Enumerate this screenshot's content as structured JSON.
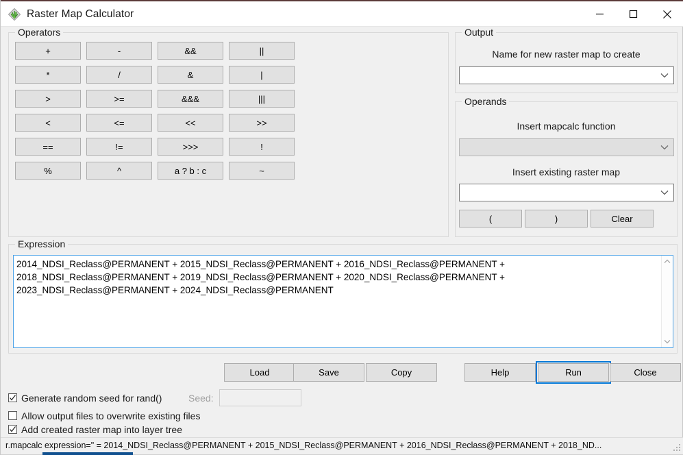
{
  "window": {
    "title": "Raster Map Calculator",
    "icon": "grass-gis-icon",
    "minimize_label": "Minimize",
    "maximize_label": "Maximize",
    "close_label": "Close"
  },
  "operators": {
    "legend": "Operators",
    "buttons": [
      "+",
      "-",
      "&&",
      "||",
      "*",
      "/",
      "&",
      "|",
      ">",
      ">=",
      "&&&",
      "|||",
      "<",
      "<=",
      "<<",
      ">>",
      "==",
      "!=",
      ">>>",
      "!",
      "%",
      "^",
      "a ? b : c",
      "~"
    ]
  },
  "output": {
    "legend": "Output",
    "name_label": "Name for new raster map to create",
    "name_value": "",
    "name_placeholder": ""
  },
  "operands": {
    "legend": "Operands",
    "function_label": "Insert mapcalc function",
    "function_value": "",
    "function_disabled": true,
    "raster_label": "Insert existing raster map",
    "raster_value": "",
    "paren_open_label": "(",
    "paren_close_label": ")",
    "clear_label": "Clear"
  },
  "expression": {
    "legend": "Expression",
    "value": "2014_NDSI_Reclass@PERMANENT + 2015_NDSI_Reclass@PERMANENT + 2016_NDSI_Reclass@PERMANENT + 2018_NDSI_Reclass@PERMANENT + 2019_NDSI_Reclass@PERMANENT + 2020_NDSI_Reclass@PERMANENT + 2023_NDSI_Reclass@PERMANENT + 2024_NDSI_Reclass@PERMANENT",
    "focus_color": "#4da3e8"
  },
  "actions": {
    "load_label": "Load",
    "save_label": "Save",
    "copy_label": "Copy",
    "help_label": "Help",
    "run_label": "Run",
    "close_label": "Close",
    "focused_button": "Run",
    "focus_color": "#0078d7"
  },
  "options": {
    "random_seed_label": "Generate random seed for rand()",
    "random_seed_checked": true,
    "seed_label": "Seed:",
    "seed_value": "",
    "seed_disabled": true,
    "overwrite_label": "Allow output files to overwrite existing files",
    "overwrite_checked": false,
    "add_layer_label": "Add created raster map into layer tree",
    "add_layer_checked": true
  },
  "statusbar": {
    "text": "r.mapcalc expression=\" = 2014_NDSI_Reclass@PERMANENT + 2015_NDSI_Reclass@PERMANENT + 2016_NDSI_Reclass@PERMANENT + 2018_ND..."
  }
}
